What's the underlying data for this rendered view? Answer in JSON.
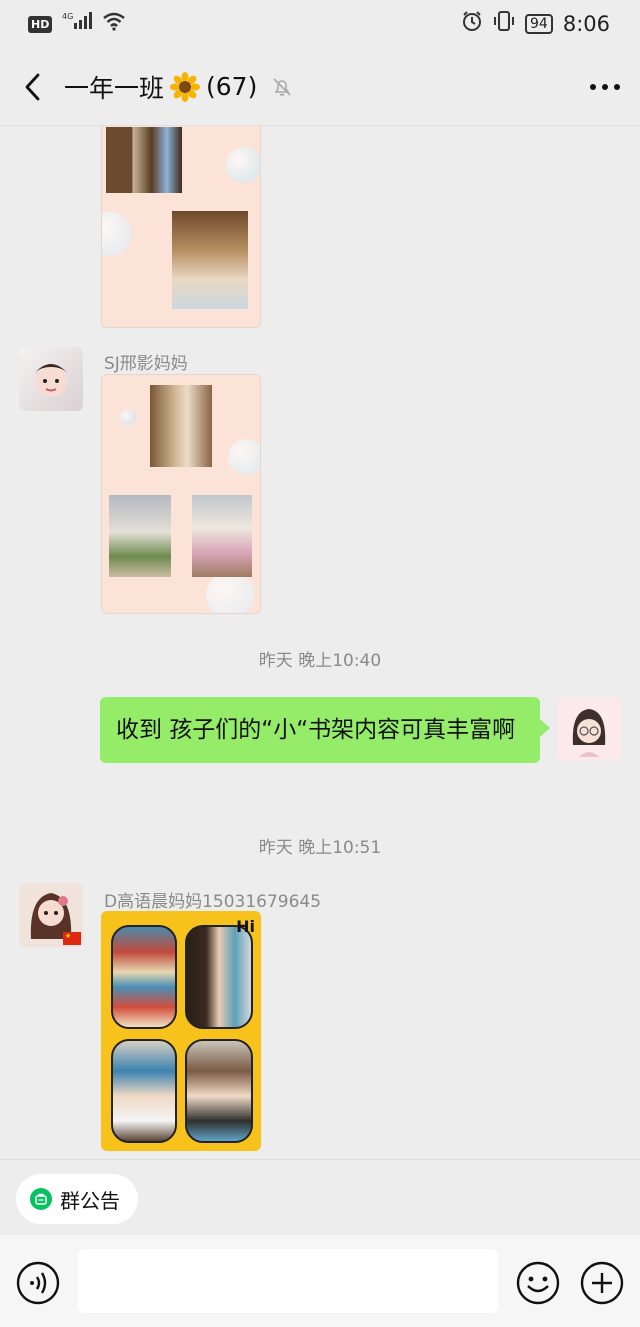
{
  "status_bar": {
    "hd": "HD",
    "network": "4G",
    "battery": "94",
    "time": "8:06"
  },
  "header": {
    "title": "一年一班",
    "member_count": "(67)",
    "icons": [
      "back-arrow-icon",
      "sunflower-emoji",
      "mute-bell-icon",
      "more-dots-icon"
    ]
  },
  "messages": [
    {
      "type": "image",
      "sender": "",
      "side": "left",
      "image_desc": "shelf-photo-collage-1"
    },
    {
      "type": "image",
      "sender": "SJ邢影妈妈",
      "side": "left",
      "image_desc": "shelf-photo-collage-2"
    },
    {
      "type": "timestamp",
      "text": "昨天 晚上10:40"
    },
    {
      "type": "text",
      "side": "right",
      "text": "收到 孩子们的“小“书架内容可真丰富啊"
    },
    {
      "type": "timestamp",
      "text": "昨天 晚上10:51"
    },
    {
      "type": "image",
      "sender": "D高语晨妈妈15031679645",
      "side": "left",
      "image_desc": "shelf-photo-collage-3"
    }
  ],
  "bottom": {
    "notice_label": "群公告",
    "input_value": "",
    "icons": [
      "voice-icon",
      "emoji-icon",
      "plus-icon"
    ]
  },
  "colors": {
    "chat_bg": "#ededed",
    "self_bubble": "#95ec69",
    "notice_green": "#07c160",
    "collage_yellow": "#f7c21b",
    "collage_pink": "#fce3d8"
  }
}
